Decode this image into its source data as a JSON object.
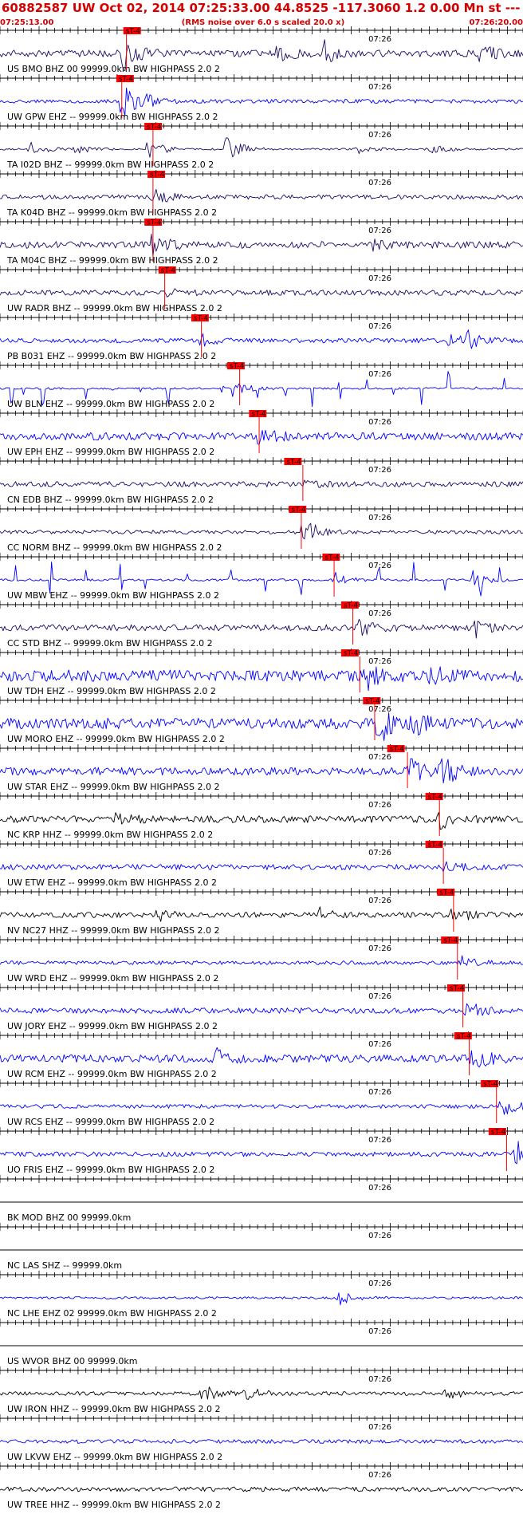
{
  "header": {
    "title": "60882587 UW Oct 02, 2014 07:25:33.00    44.8525 -117.3060  1.2 0.00 Mn st --- -- --   -1",
    "start_time": "07:25:13.00",
    "noise_note": "(RMS noise over 6.0 s scaled 20.0 x)",
    "end_time": "07:26:20.00"
  },
  "colors": {
    "header_text": "#d40000",
    "pick_marker": "#ff0000",
    "trace_blue": "#0000ff",
    "trace_navy": "#1a0a66",
    "trace_black": "#000000",
    "axis": "#000000"
  },
  "chart_data": {
    "type": "line",
    "x_unit": "seconds from 07:25:13.00",
    "xlim": [
      0,
      67
    ],
    "minute_mark": {
      "t": 47,
      "label": "07:26"
    },
    "pick_label": "sT-4",
    "traces": [
      {
        "label": "US BMO BHZ 00 99999.0km BW  HIGHPASS  2.0  2",
        "color": "navy",
        "pick_t": 15.8,
        "pick_end_t": 16.2,
        "bursts": [
          [
            15.8,
            0.9
          ],
          [
            35.5,
            0.5
          ],
          [
            41.5,
            0.6
          ],
          [
            61.5,
            0.4
          ]
        ],
        "noise": 0.18
      },
      {
        "label": "UW GPW EHZ -- 99999.0km BW  HIGHPASS  2.0  2",
        "color": "blue",
        "pick_t": 14.9,
        "pick_end_t": 15.6,
        "bursts": [
          [
            15.6,
            1.0
          ],
          [
            18.0,
            0.35
          ]
        ],
        "noise": 0.1
      },
      {
        "label": "TA I02D BHZ -- 99999.0km BW  HIGHPASS  2.0  2",
        "color": "navy",
        "pick_t": 18.5,
        "pick_end_t": 19.6,
        "bursts": [
          [
            4.0,
            0.35
          ],
          [
            9.5,
            0.3
          ],
          [
            19.0,
            0.6
          ],
          [
            29.0,
            0.75
          ],
          [
            46.0,
            0.3
          ],
          [
            55.0,
            0.3
          ]
        ],
        "noise": 0.05
      },
      {
        "label": "TA K04D BHZ -- 99999.0km BW  HIGHPASS  2.0  2",
        "color": "navy",
        "pick_t": 18.9,
        "pick_end_t": 19.6,
        "bursts": [
          [
            19.6,
            0.55
          ]
        ],
        "noise": 0.12
      },
      {
        "label": "TA M04C BHZ -- 99999.0km BW  HIGHPASS  2.0  2",
        "color": "navy",
        "pick_t": 18.5,
        "pick_end_t": 19.6,
        "bursts": [
          [
            19.5,
            0.5
          ],
          [
            48.0,
            0.3
          ]
        ],
        "noise": 0.18
      },
      {
        "label": "UW RADR BHZ -- 99999.0km BW  HIGHPASS  2.0  2",
        "color": "navy",
        "pick_t": 20.3,
        "pick_end_t": 21.1,
        "bursts": [
          [
            21.0,
            0.25
          ]
        ],
        "noise": 0.14
      },
      {
        "label": "PB B031 EHZ -- 99999.0km BW  HIGHPASS  2.0  2",
        "color": "blue",
        "pick_t": 24.5,
        "pick_end_t": 25.8,
        "bursts": [
          [
            25.8,
            0.3
          ],
          [
            57.5,
            0.45
          ],
          [
            60.0,
            0.35
          ]
        ],
        "noise": 0.12
      },
      {
        "label": "UW BLN EHZ -- 99999.0km BW  HIGHPASS  2.0  2",
        "color": "blue",
        "pick_t": 29.1,
        "pick_end_t": 30.7,
        "bursts": [
          [
            30.5,
            0.3
          ]
        ],
        "noise": 0.05,
        "spikes": [
          1.5,
          3.0,
          5.5,
          8.0,
          11.0,
          14.5,
          18.0,
          21.5,
          25.0,
          28.5,
          29.8,
          33.0,
          36.5,
          40.0,
          43.5,
          47.0,
          50.5,
          54.0,
          57.5,
          61.0,
          64.5
        ]
      },
      {
        "label": "UW EPH EHZ -- 99999.0km BW  HIGHPASS  2.0  2",
        "color": "blue",
        "pick_t": 31.9,
        "pick_end_t": 33.2,
        "bursts": [
          [
            33.0,
            0.45
          ]
        ],
        "noise": 0.2
      },
      {
        "label": "CN EDB BHZ -- 99999.0km BW  HIGHPASS  2.0  2",
        "color": "navy",
        "pick_t": 36.4,
        "pick_end_t": 38.8,
        "bursts": [
          [
            38.5,
            0.25
          ]
        ],
        "noise": 0.14
      },
      {
        "label": "CC NORM BHZ -- 99999.0km BW  HIGHPASS  2.0  2",
        "color": "navy",
        "pick_t": 37.0,
        "pick_end_t": 38.6,
        "bursts": [
          [
            38.8,
            0.9
          ]
        ],
        "noise": 0.1
      },
      {
        "label": "UW MBW EHZ -- 99999.0km BW  HIGHPASS  2.0  2",
        "color": "blue",
        "pick_t": 41.3,
        "pick_end_t": 42.8,
        "bursts": [
          [
            42.8,
            0.4
          ],
          [
            60.5,
            0.5
          ]
        ],
        "noise": 0.06,
        "spikes": [
          2.0,
          6.5,
          11.0,
          15.5,
          18.5,
          24.0,
          29.5,
          34.0,
          38.5,
          43.5,
          48.5,
          53.0,
          57.0,
          61.5,
          64.0
        ]
      },
      {
        "label": "CC STD BHZ -- 99999.0km BW  HIGHPASS  2.0  2",
        "color": "navy",
        "pick_t": 43.7,
        "pick_end_t": 45.2,
        "bursts": [
          [
            46.0,
            0.4
          ],
          [
            61.0,
            0.4
          ]
        ],
        "noise": 0.16
      },
      {
        "label": "UW TDH EHZ -- 99999.0km BW  HIGHPASS  2.0  2",
        "color": "blue",
        "pick_t": 43.7,
        "pick_end_t": 46.1,
        "bursts": [
          [
            47.0,
            0.55
          ],
          [
            55.0,
            0.5
          ]
        ],
        "noise": 0.3
      },
      {
        "label": "UW MORO EHZ -- 99999.0km BW  HIGHPASS  2.0  2",
        "color": "blue",
        "pick_t": 46.5,
        "pick_end_t": 48.0,
        "bursts": [
          [
            48.5,
            1.0
          ],
          [
            53.0,
            0.6
          ]
        ],
        "noise": 0.28
      },
      {
        "label": "UW STAR EHZ -- 99999.0km BW  HIGHPASS  2.0  2",
        "color": "blue",
        "pick_t": 49.6,
        "pick_end_t": 52.2,
        "bursts": [
          [
            52.5,
            0.6
          ],
          [
            56.5,
            1.0
          ]
        ],
        "noise": 0.2
      },
      {
        "label": "NC KRP HHZ -- 99999.0km BW  HIGHPASS  2.0  2",
        "color": "black",
        "pick_t": 54.5,
        "pick_end_t": 56.3,
        "bursts": [
          [
            15.0,
            0.3
          ],
          [
            56.3,
            0.45
          ]
        ],
        "noise": 0.18
      },
      {
        "label": "UW ETW EHZ -- 99999.0km BW  HIGHPASS  2.0  2",
        "color": "blue",
        "pick_t": 54.5,
        "pick_end_t": 56.8,
        "bursts": [
          [
            57.0,
            0.3
          ]
        ],
        "noise": 0.14
      },
      {
        "label": "NV NC27 HHZ -- 99999.0km BW  HIGHPASS  2.0  2",
        "color": "black",
        "pick_t": 56.0,
        "pick_end_t": 58.1,
        "bursts": [
          [
            20.0,
            0.3
          ],
          [
            41.0,
            0.3
          ],
          [
            58.1,
            0.45
          ]
        ],
        "noise": 0.14
      },
      {
        "label": "UW WRD EHZ -- 99999.0km BW  HIGHPASS  2.0  2",
        "color": "blue",
        "pick_t": 56.5,
        "pick_end_t": 58.6,
        "bursts": [
          [
            59.0,
            0.35
          ]
        ],
        "noise": 0.1
      },
      {
        "label": "UW JORY EHZ -- 99999.0km BW  HIGHPASS  2.0  2",
        "color": "blue",
        "pick_t": 57.3,
        "pick_end_t": 59.3,
        "bursts": [
          [
            59.8,
            0.5
          ]
        ],
        "noise": 0.14
      },
      {
        "label": "UW RCM EHZ -- 99999.0km BW  HIGHPASS  2.0  2",
        "color": "blue",
        "pick_t": 58.2,
        "pick_end_t": 60.1,
        "bursts": [
          [
            27.5,
            0.45
          ],
          [
            60.5,
            0.65
          ]
        ],
        "noise": 0.2
      },
      {
        "label": "UW RCS EHZ -- 99999.0km BW  HIGHPASS  2.0  2",
        "color": "blue",
        "pick_t": 61.6,
        "pick_end_t": 63.6,
        "bursts": [
          [
            64.0,
            0.6
          ]
        ],
        "noise": 0.1
      },
      {
        "label": "UO FRIS EHZ -- 99999.0km BW  HIGHPASS  2.0  2",
        "color": "blue",
        "pick_t": 62.6,
        "pick_end_t": 64.9,
        "bursts": [
          [
            66.0,
            0.75
          ]
        ],
        "noise": 0.12
      },
      {
        "label": "BK MOD BHZ 00 99999.0km",
        "color": "black",
        "bursts": [],
        "noise": 0
      },
      {
        "label": "NC LAS SHZ -- 99999.0km",
        "color": "black",
        "bursts": [],
        "noise": 0
      },
      {
        "label": "NC LHE EHZ 02 99999.0km BW  HIGHPASS  2.0  2",
        "color": "blue",
        "bursts": [
          [
            43.5,
            0.35
          ]
        ],
        "noise": 0.06
      },
      {
        "label": "US WVOR BHZ 00 99999.0km",
        "color": "black",
        "bursts": [],
        "noise": 0
      },
      {
        "label": "UW IRON HHZ -- 99999.0km BW  HIGHPASS  2.0  2",
        "color": "black",
        "bursts": [
          [
            26.0,
            0.45
          ],
          [
            31.5,
            0.35
          ],
          [
            57.0,
            0.35
          ]
        ],
        "noise": 0.1
      },
      {
        "label": "UW LKVW EHZ -- 99999.0km BW  HIGHPASS  2.0  2",
        "color": "blue",
        "bursts": [],
        "noise": 0.1
      },
      {
        "label": "UW TREE HHZ -- 99999.0km BW  HIGHPASS  2.0  2",
        "color": "black",
        "bursts": [],
        "noise": 0.12
      }
    ]
  }
}
